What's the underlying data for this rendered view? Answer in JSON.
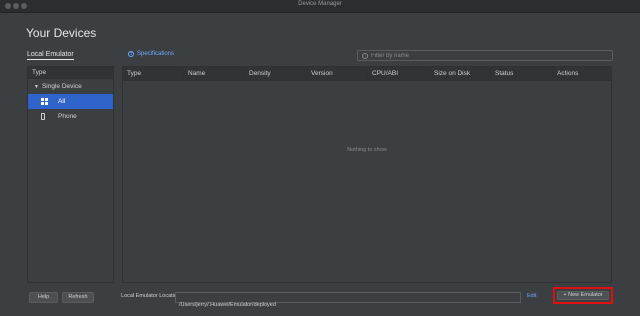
{
  "window": {
    "title": "Device Manager"
  },
  "header": {
    "title": "Your Devices"
  },
  "tabs": {
    "local_emulator": "Local Emulator"
  },
  "specifications_link": "Specifications",
  "filter": {
    "placeholder": "Filter by name"
  },
  "sidebar": {
    "header": "Type",
    "group": "Single Device",
    "items": [
      {
        "label": "All",
        "icon": "grid-icon",
        "selected": true
      },
      {
        "label": "Phone",
        "icon": "phone-icon",
        "selected": false
      }
    ]
  },
  "table": {
    "columns": [
      "Type",
      "Name",
      "Density",
      "Version",
      "CPU/ABI",
      "Size on Disk",
      "Status",
      "Actions"
    ],
    "empty_message": "Nothing to show"
  },
  "footer": {
    "help_label": "Help",
    "refresh_label": "Refresh",
    "location_label": "Local Emulator Location:",
    "location_value": "/Users/jerry/.Huawei/Emulator/deployed",
    "edit_label": "Edit",
    "new_emulator_label": "+ New Emulator"
  },
  "colors": {
    "accent": "#2f65ca",
    "link": "#6ea8ff",
    "highlight": "#e01010",
    "background": "#3c3f41"
  }
}
